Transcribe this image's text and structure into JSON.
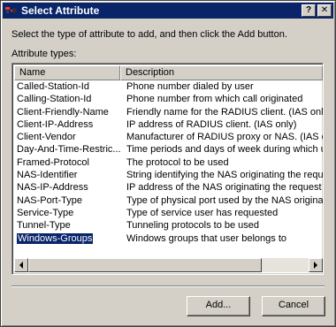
{
  "window": {
    "title": "Select Attribute",
    "help_glyph": "?",
    "close_glyph": "✕"
  },
  "instruction": "Select the type of attribute to add, and then click the Add button.",
  "types_label": "Attribute types:",
  "list": {
    "columns": [
      "Name",
      "Description"
    ],
    "rows": [
      {
        "name": "Called-Station-Id",
        "description": "Phone number dialed by user"
      },
      {
        "name": "Calling-Station-Id",
        "description": "Phone number from which call originated"
      },
      {
        "name": "Client-Friendly-Name",
        "description": "Friendly name for the RADIUS client. (IAS only)"
      },
      {
        "name": "Client-IP-Address",
        "description": "IP address of RADIUS client. (IAS only)"
      },
      {
        "name": "Client-Vendor",
        "description": "Manufacturer of RADIUS proxy or NAS. (IAS onl"
      },
      {
        "name": "Day-And-Time-Restric...",
        "description": "Time periods and days of week during which use"
      },
      {
        "name": "Framed-Protocol",
        "description": "The protocol to be used"
      },
      {
        "name": "NAS-Identifier",
        "description": "String identifying the NAS originating the request"
      },
      {
        "name": "NAS-IP-Address",
        "description": "IP address of the NAS originating the request (IA"
      },
      {
        "name": "NAS-Port-Type",
        "description": "Type of physical port used by the NAS originatin"
      },
      {
        "name": "Service-Type",
        "description": "Type of service user has requested"
      },
      {
        "name": "Tunnel-Type",
        "description": "Tunneling protocols to be used"
      },
      {
        "name": "Windows-Groups",
        "description": "Windows groups that user belongs to"
      }
    ],
    "selected_index": 12
  },
  "buttons": {
    "add": "Add...",
    "cancel": "Cancel"
  },
  "icons": {
    "title": "ias-attribute-icon",
    "help": "help-icon",
    "close": "close-icon",
    "scroll_left": "arrow-left-icon",
    "scroll_right": "arrow-right-icon"
  },
  "colors": {
    "title_bar": "#0a246a",
    "dialog_face": "#d4d0c8",
    "selection": "#0a246a"
  }
}
